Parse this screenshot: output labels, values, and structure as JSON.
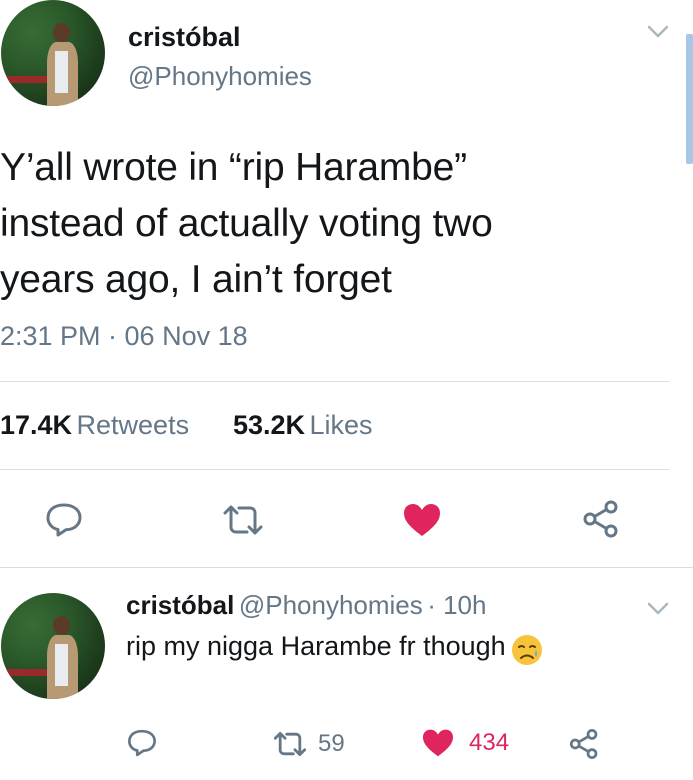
{
  "tweet": {
    "author_name": "cristóbal",
    "author_handle": "@Phonyhomies",
    "text_lines": [
      "Y’all wrote in “rip Harambe”",
      "instead of actually voting two",
      "years ago, I ain’t forget"
    ],
    "timestamp": "2:31 PM · 06 Nov 18",
    "retweets_count": "17.4K",
    "retweets_label": "Retweets",
    "likes_count": "53.2K",
    "likes_label": "Likes",
    "icons": [
      "chevron-down-icon",
      "reply-icon",
      "retweet-icon",
      "heart-icon",
      "share-icon"
    ],
    "liked": true
  },
  "reply": {
    "author_name": "cristóbal",
    "author_handle": "@Phonyhomies",
    "time_ago": "· 10h",
    "text": "rip my nigga Harambe fr though",
    "emoji": "😥",
    "retweets_count": "59",
    "likes_count": "434",
    "liked": true
  },
  "colors": {
    "like_red": "#e0245e",
    "icon_gray": "#657786",
    "divider": "#d9dde1"
  }
}
